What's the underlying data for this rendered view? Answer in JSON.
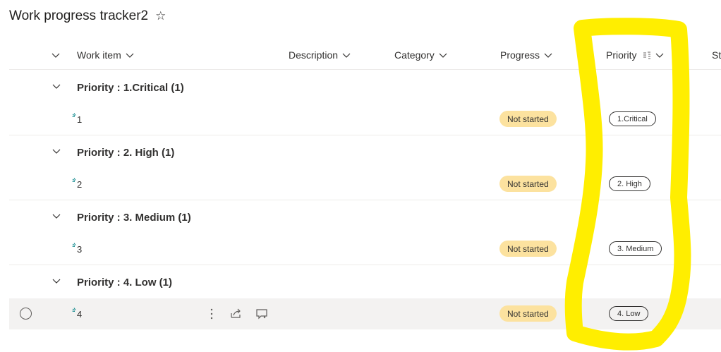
{
  "list": {
    "title": "Work progress tracker2",
    "favorite_icon": "star-outline-icon"
  },
  "columns": {
    "work_item": "Work item",
    "description": "Description",
    "category": "Category",
    "progress": "Progress",
    "priority": "Priority",
    "status_partial": "St"
  },
  "groups": [
    {
      "title": "Priority : 1.Critical (1)",
      "item": "1",
      "progress": "Not started",
      "priority": "1.Critical"
    },
    {
      "title": "Priority : 2. High (1)",
      "item": "2",
      "progress": "Not started",
      "priority": "2. High"
    },
    {
      "title": "Priority : 3. Medium (1)",
      "item": "3",
      "progress": "Not started",
      "priority": "3. Medium"
    },
    {
      "title": "Priority : 4. Low (1)",
      "item": "4",
      "progress": "Not started",
      "priority": "4. Low"
    }
  ],
  "colors": {
    "progress_pill": "#fce29f",
    "new_item_indicator": "#038387",
    "annotation_highlight": "#ffee00"
  }
}
